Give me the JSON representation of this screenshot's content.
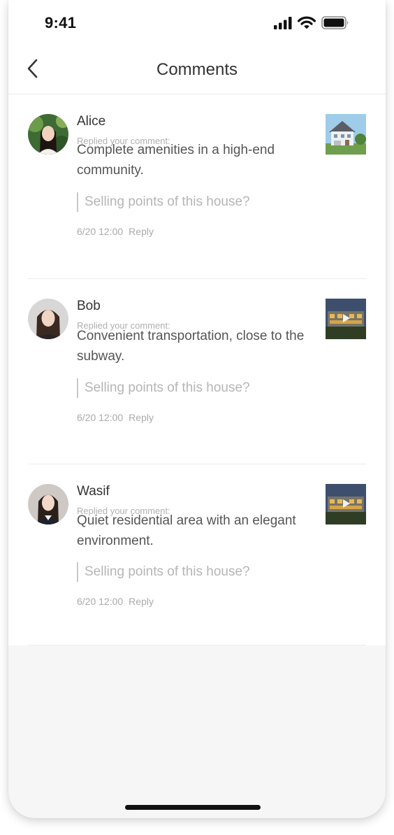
{
  "status_bar": {
    "time": "9:41",
    "icons": [
      "signal-icon",
      "wifi-icon",
      "battery-icon"
    ]
  },
  "header": {
    "title": "Comments",
    "back_icon": "chevron-left-icon"
  },
  "comments": [
    {
      "name": "Alice",
      "replied_label": "Replied your comment:",
      "text": "Complete amenities in a high-end community.",
      "quote": "Selling points of this house?",
      "time": "6/20 12:00",
      "reply_label": "Reply"
    },
    {
      "name": "Bob",
      "replied_label": "Replied your comment:",
      "text": "Convenient transportation, close to the subway.",
      "quote": "Selling points of this house?",
      "time": "6/20 12:00",
      "reply_label": "Reply"
    },
    {
      "name": "Wasif",
      "replied_label": "Replied your comment:",
      "text": "Quiet residential area with an elegant environment.",
      "quote": "Selling points of this house?",
      "time": "6/20 12:00",
      "reply_label": "Reply"
    }
  ],
  "colors": {
    "page_background": "#f6f6f6",
    "card_background": "#ffffff",
    "primary_text": "#333333",
    "secondary_text": "#aaaaaa"
  }
}
